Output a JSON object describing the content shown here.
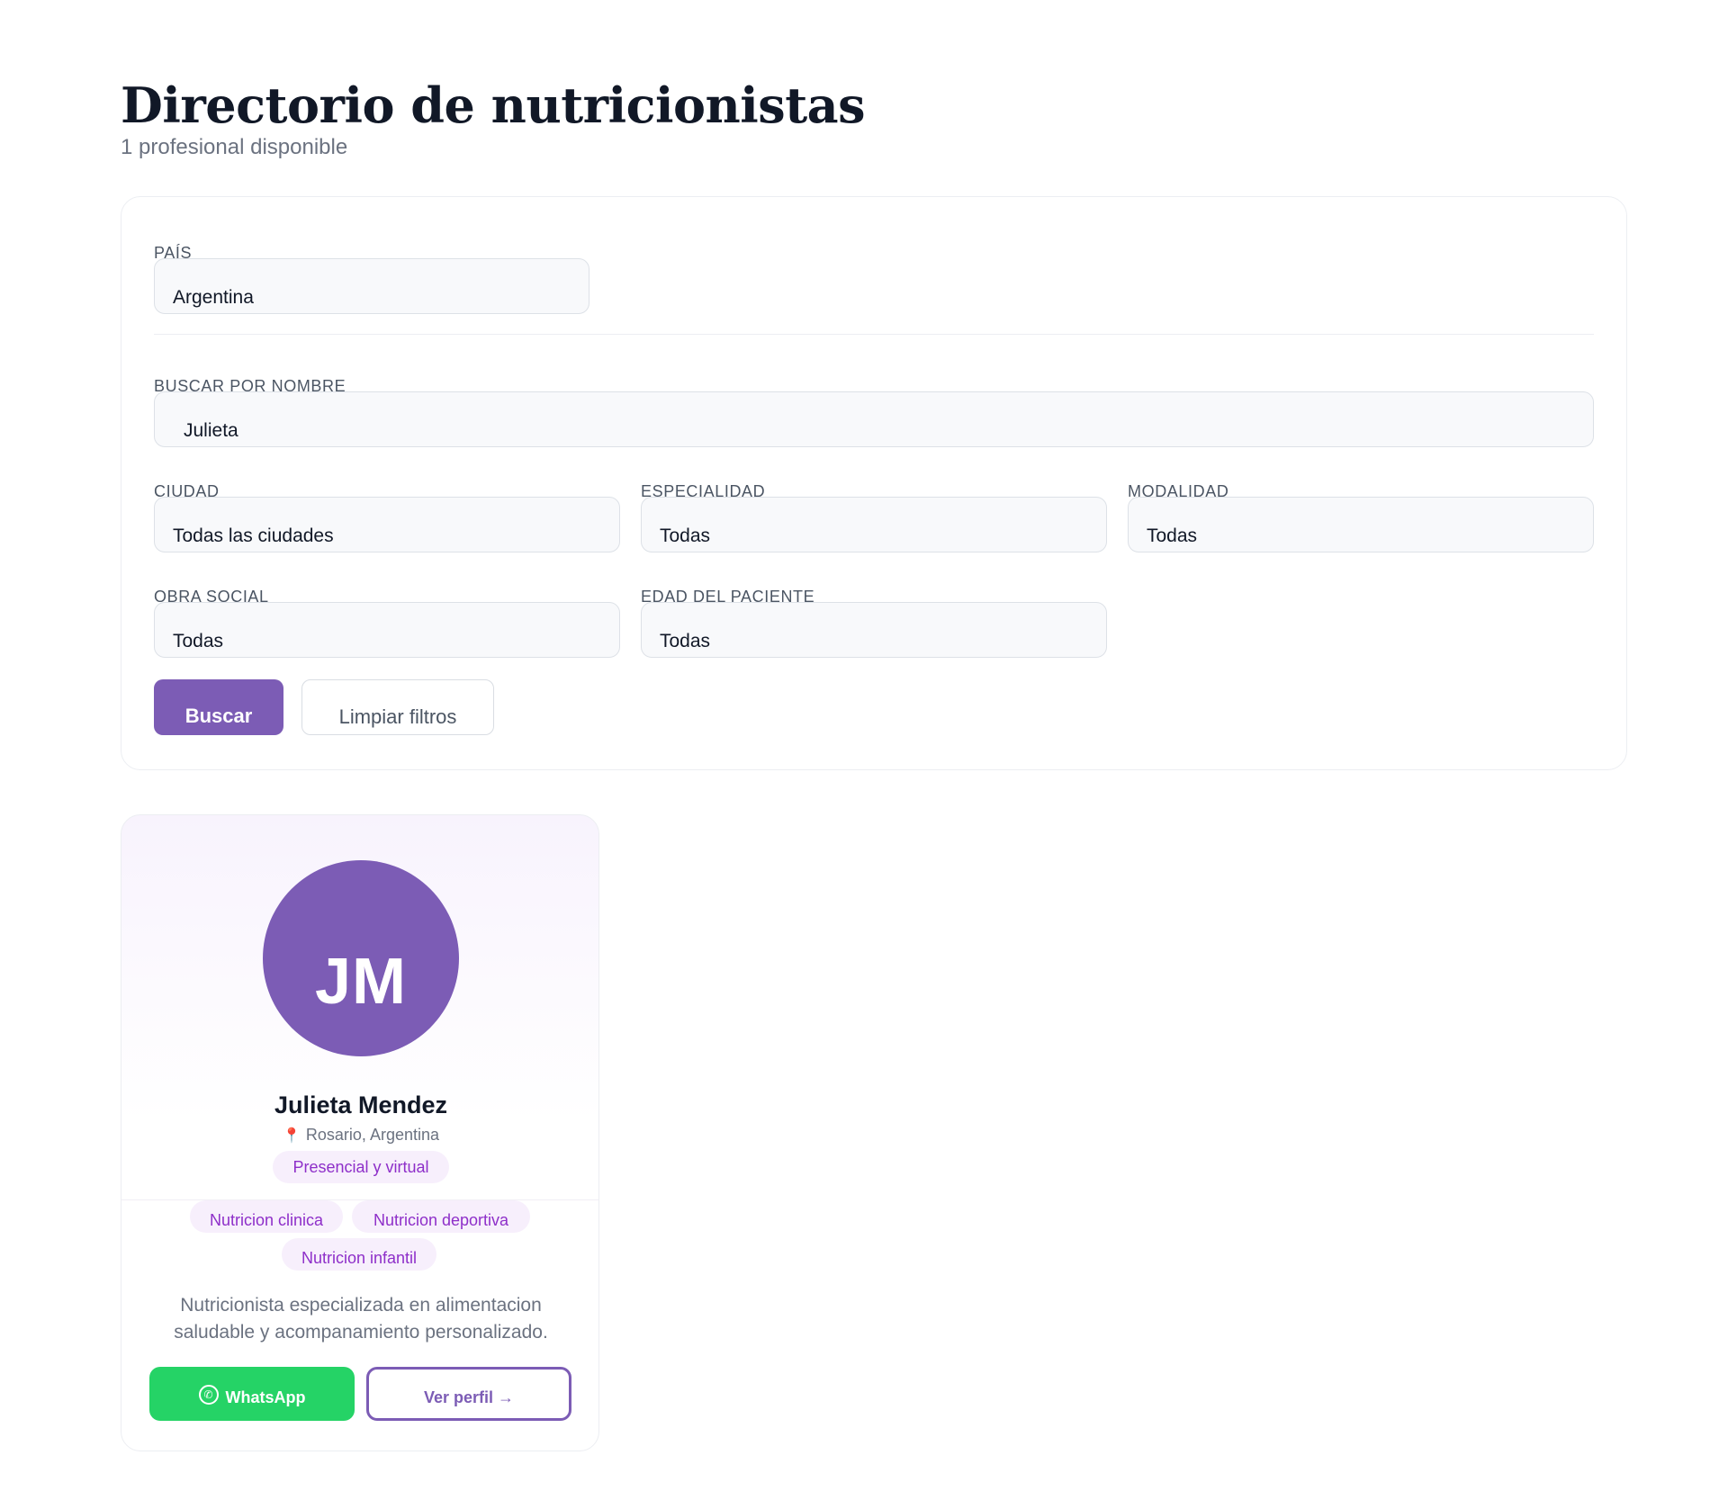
{
  "header": {
    "title": "Directorio de nutricionistas",
    "subtitle": "1 profesional disponible"
  },
  "filters": {
    "country": {
      "label": "PAÍS",
      "value": "Argentina"
    },
    "name_search": {
      "label": "BUSCAR POR NOMBRE",
      "value": "Julieta"
    },
    "city": {
      "label": "CIUDAD",
      "value": "Todas las ciudades"
    },
    "specialty": {
      "label": "ESPECIALIDAD",
      "value": "Todas"
    },
    "modality": {
      "label": "MODALIDAD",
      "value": "Todas"
    },
    "insurance": {
      "label": "OBRA SOCIAL",
      "value": "Todas"
    },
    "patient_age": {
      "label": "EDAD DEL PACIENTE",
      "value": "Todas"
    },
    "search_button": "Buscar",
    "clear_button": "Limpiar filtros"
  },
  "results": [
    {
      "initials": "JM",
      "name": "Julieta Mendez",
      "location": "Rosario, Argentina",
      "modality": "Presencial y virtual",
      "specialties": [
        "Nutricion clinica",
        "Nutricion deportiva",
        "Nutricion infantil"
      ],
      "description": "Nutricionista especializada en alimentacion saludable y acompanamiento personalizado.",
      "whatsapp_label": "WhatsApp",
      "profile_label": "Ver perfil →"
    }
  ],
  "colors": {
    "brand": "#7c5cb5",
    "whatsapp": "#25d366",
    "tag_text": "#8e2fc9",
    "tag_bg": "#f7effc"
  },
  "icons": {
    "location": "pin-icon",
    "whatsapp": "whatsapp-icon"
  }
}
